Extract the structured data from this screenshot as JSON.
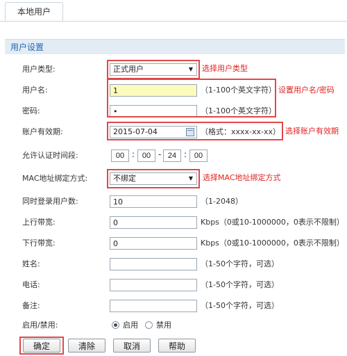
{
  "tab": {
    "label": "本地用户"
  },
  "section": {
    "title": "用户设置"
  },
  "fields": {
    "user_type": {
      "label": "用户类型:",
      "value": "正式用户",
      "annotation": "选择用户类型"
    },
    "username": {
      "label": "用户名:",
      "value": "1",
      "hint": "（1-100个英文字符）",
      "annotation": "设置用户名/密码"
    },
    "password": {
      "label": "密码:",
      "value": "•",
      "hint": "（1-100个英文字符）"
    },
    "expiry": {
      "label": "账户有效期:",
      "value": "2015-07-04",
      "hint": "（格式：xxxx-xx-xx）",
      "annotation": "选择账户有效期"
    },
    "auth_time": {
      "label": "允许认证时间段:",
      "start_h": "00",
      "start_m": "00",
      "end_h": "24",
      "end_m": "00",
      "colon": ":",
      "dash": "-"
    },
    "mac_bind": {
      "label": "MAC地址绑定方式:",
      "value": "不绑定",
      "annotation": "选择MAC地址绑定方式"
    },
    "concurrent": {
      "label": "同时登录用户数:",
      "value": "10",
      "hint": "（1-2048）"
    },
    "upload": {
      "label": "上行带宽:",
      "value": "0",
      "hint": "Kbps（0或10-1000000，0表示不限制）"
    },
    "download": {
      "label": "下行带宽:",
      "value": "0",
      "hint": "Kbps（0或10-1000000，0表示不限制）"
    },
    "name": {
      "label": "姓名:",
      "value": "",
      "hint": "（1-50个字符，可选）"
    },
    "phone": {
      "label": "电话:",
      "value": "",
      "hint": "（1-50个字符，可选）"
    },
    "remark": {
      "label": "备注:",
      "value": "",
      "hint": "（1-50个字符，可选）"
    },
    "status": {
      "label": "启用/禁用:",
      "enable": "启用",
      "disable": "禁用",
      "selected": "启用"
    }
  },
  "buttons": {
    "confirm": "确定",
    "clear": "清除",
    "cancel": "取消",
    "help": "帮助"
  },
  "colors": {
    "accent": "#2467b0",
    "annotation": "#e02222",
    "highlight_field": "#fbfbbd"
  },
  "icons": {
    "select_arrow": "chevron-down-icon",
    "calendar": "calendar-icon"
  }
}
